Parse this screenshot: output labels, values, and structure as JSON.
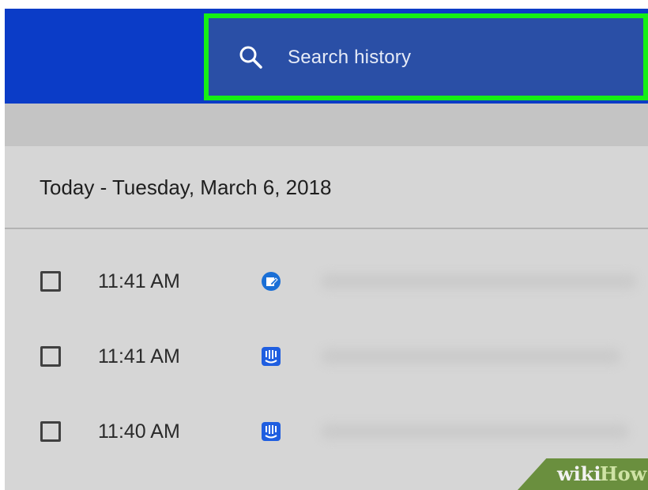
{
  "header": {
    "search": {
      "placeholder": "Search history"
    }
  },
  "history": {
    "date_header": "Today - Tuesday, March 6, 2018",
    "items": [
      {
        "time": "11:41 AM",
        "icon": "circle-edit-icon",
        "icon_color": "#1a6fd6"
      },
      {
        "time": "11:41 AM",
        "icon": "intercom-icon",
        "icon_color": "#1f5ee0"
      },
      {
        "time": "11:40 AM",
        "icon": "intercom-icon",
        "icon_color": "#1f5ee0"
      }
    ]
  },
  "watermark": {
    "wiki": "wiki",
    "how": "How"
  },
  "colors": {
    "topbar": "#0b3cc7",
    "search_box": "#2a4fa6",
    "highlight": "#15f015",
    "content_bg": "#d6d6d6"
  }
}
